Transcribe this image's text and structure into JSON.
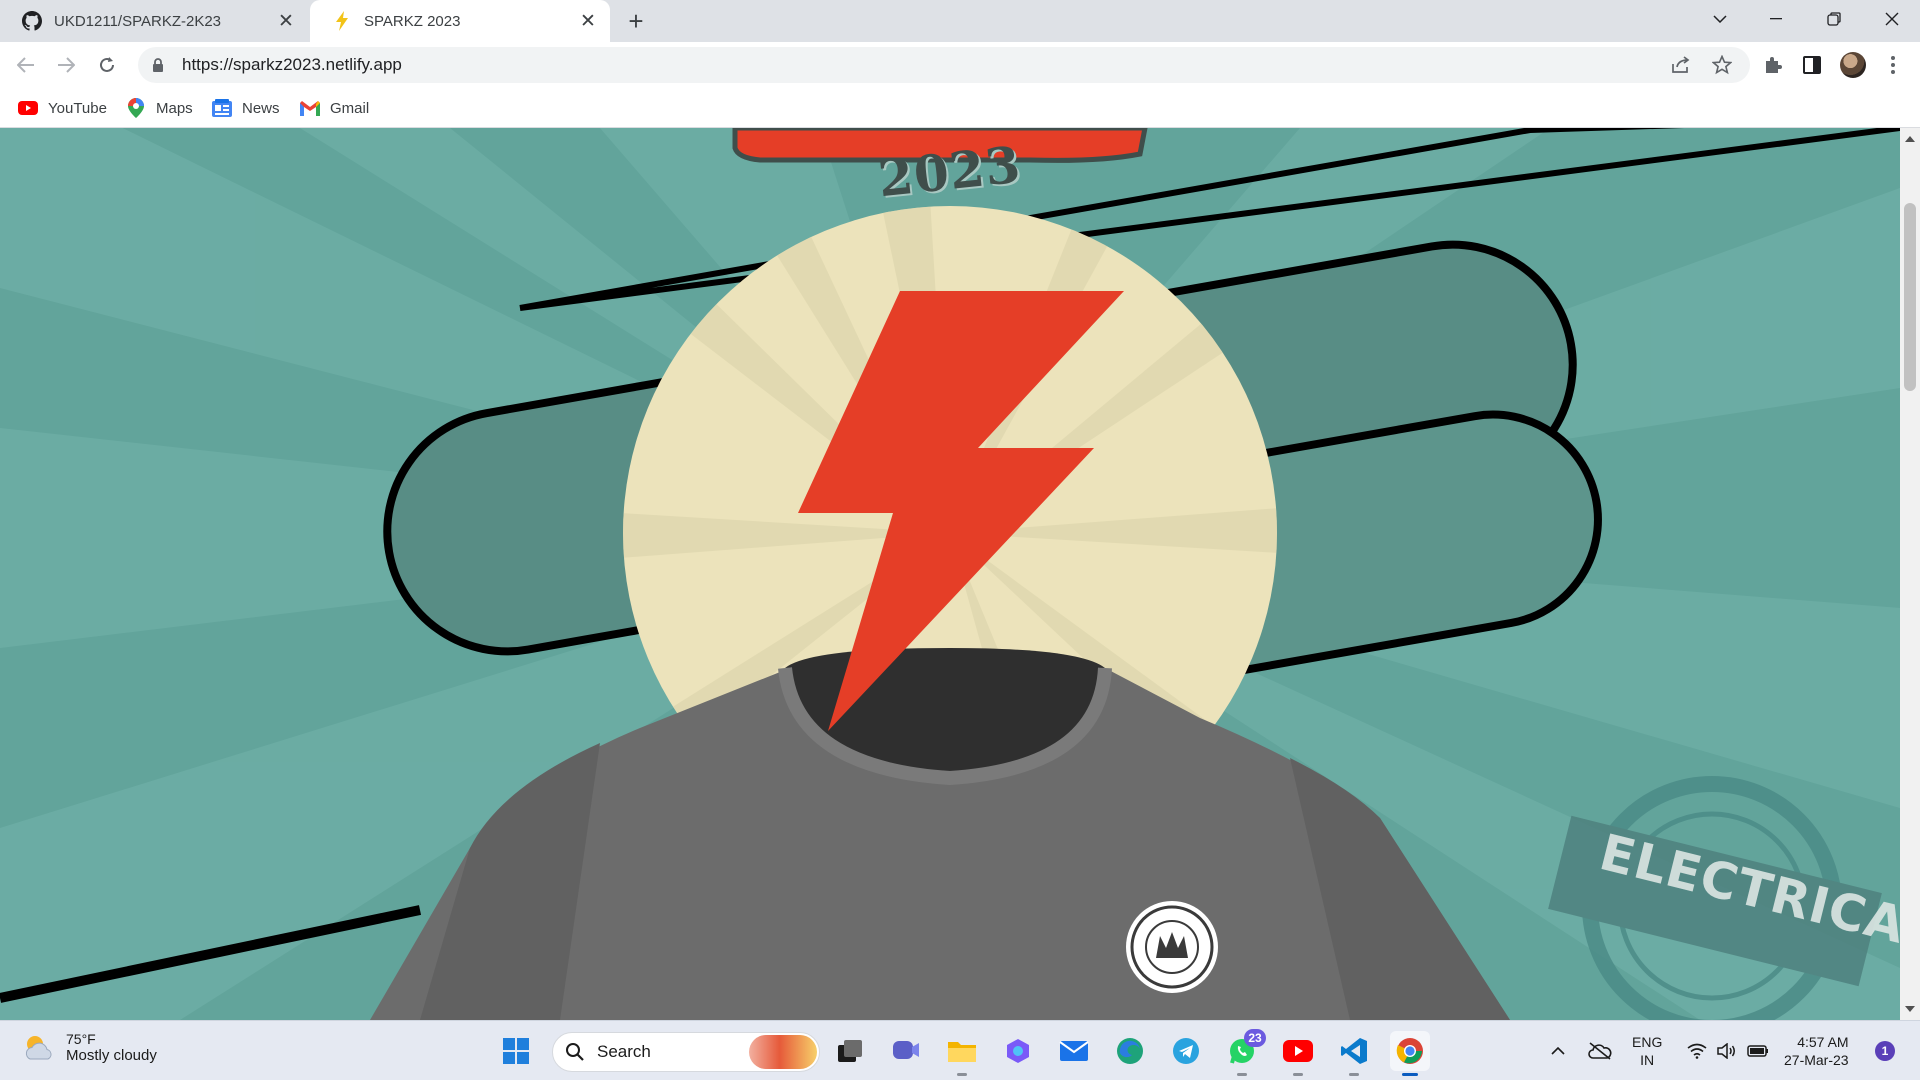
{
  "browser": {
    "tabs": [
      {
        "title": "UKD1211/SPARKZ-2K23",
        "favicon": "github-icon",
        "active": false
      },
      {
        "title": "SPARKZ 2023",
        "favicon": "lightning-bolt-icon",
        "active": true
      }
    ],
    "url": "https://sparkz2023.netlify.app",
    "bookmarks": [
      {
        "label": "YouTube",
        "icon": "youtube-icon"
      },
      {
        "label": "Maps",
        "icon": "maps-pin-icon"
      },
      {
        "label": "News",
        "icon": "google-news-icon"
      },
      {
        "label": "Gmail",
        "icon": "gmail-icon"
      }
    ]
  },
  "page": {
    "year": "2023",
    "stamp_label": "ELECTRICAL",
    "colors": {
      "background": "#62a49b",
      "bolt": "#e53e27",
      "sun": "#ece3bb",
      "tshirt": "#6c6c6c"
    }
  },
  "taskbar": {
    "weather_temp": "75°F",
    "weather_condition": "Mostly cloudy",
    "search_label": "Search",
    "whatsapp_badge": "23",
    "language": "ENG",
    "region": "IN",
    "time": "4:57 AM",
    "date": "27-Mar-23",
    "notification_count": "1"
  }
}
